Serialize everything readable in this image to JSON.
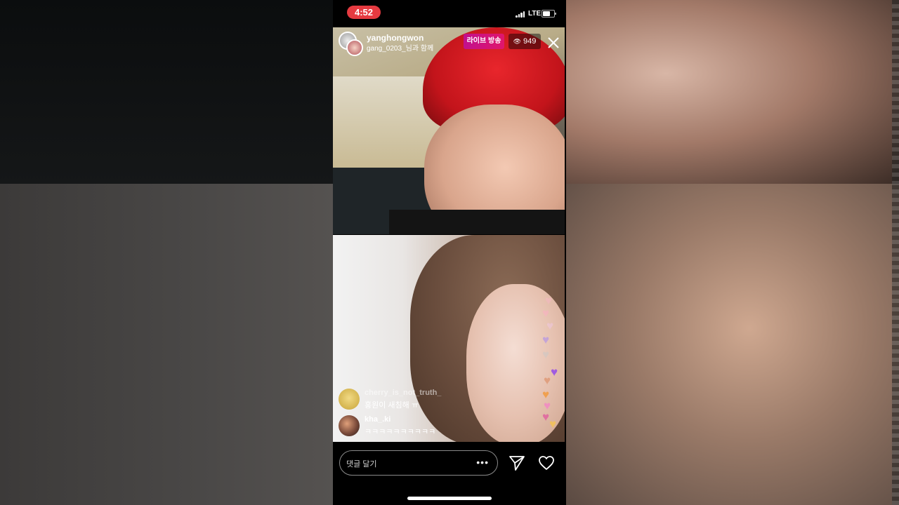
{
  "status_bar": {
    "time": "4:52",
    "network": "LTE"
  },
  "live": {
    "host_username": "yanghongwon",
    "guest_line": "gang_0203_님과 함께",
    "badge": "라이브 방송",
    "viewer_count": "949"
  },
  "comments": [
    {
      "username": "cherry_is_not_truth_",
      "text": "홍원이 새침해 ㅠ"
    },
    {
      "username": "kha_.ki",
      "text": "ㅋㅋㅋㅋㅋㅋㅋㅋㅋㅋ"
    }
  ],
  "comment_box": {
    "placeholder": "댓글 달기"
  },
  "icons": [
    "close-icon",
    "eye-icon",
    "more-icon",
    "send-icon",
    "heart-icon",
    "signal-icon",
    "battery-icon"
  ],
  "colors": {
    "recording_pill": "#e53a40",
    "live_badge": "#d0127c",
    "background": "#000000"
  }
}
